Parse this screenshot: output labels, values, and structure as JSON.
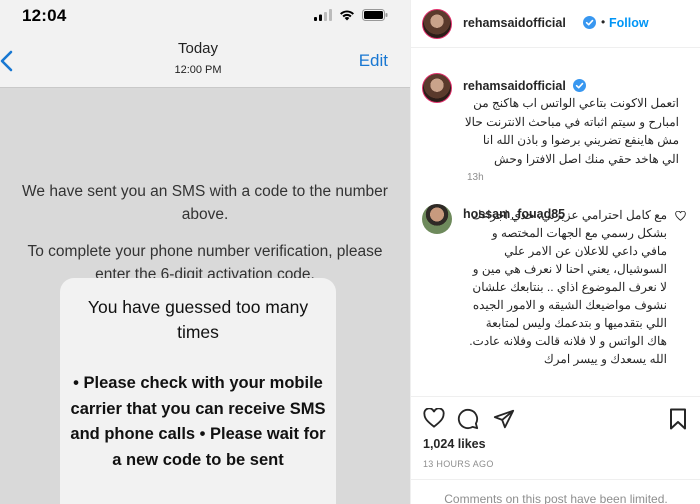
{
  "phone": {
    "status_time": "12:04",
    "nav": {
      "day": "Today",
      "time": "12:00 PM",
      "edit_label": "Edit"
    },
    "message1": "We have sent you an SMS with a code to the number above.",
    "message2": "To complete your phone number verification, please enter the 6-digit activation code.",
    "alert": {
      "title": "You have guessed too many times",
      "body": "• Please check with your mobile carrier that you can receive SMS and phone calls • Please wait for a new code to be sent"
    }
  },
  "instagram": {
    "header": {
      "username": "rehamsaidofficial",
      "dot": "•",
      "follow_label": "Follow"
    },
    "caption": {
      "username": "rehamsaidofficial",
      "text": "اتعمل الاكونت بتاعي الواتس اب هاكنج من امبارح و سيتم اثباته في مباحث الانترنت حالا مش هاينفع تضريني برضوا و باذن الله انا الي هاخد حقي منك اصل الافترا وحش",
      "time": "13h"
    },
    "comment": {
      "username": "hossam_fouad85",
      "text": "مع كامل احترامي عزيزتي، خدي اجراءك بشكل رسمي مع الجهات المختصه و مافي داعي للاعلان عن الامر علي السوشيال، يعني احنا لا نعرف هي مين و لا نعرف الموضوع اذاي .. بنتابعك علشان نشوف مواضيعك الشيقه و الامور الجيده اللي بتقدميها و بتدعمك وليس لمتابعة هاك الواتس و لا فلانه قالت وفلانه عادت. الله يسعدك و ييسر امرك"
    },
    "likes": "1,024 likes",
    "posted_ago": "13 HOURS AGO",
    "comments_limited": "Comments on this post have been limited."
  },
  "colors": {
    "accent": "#0095f6",
    "ios_blue": "#1877d2",
    "verified": "#3897f0"
  }
}
